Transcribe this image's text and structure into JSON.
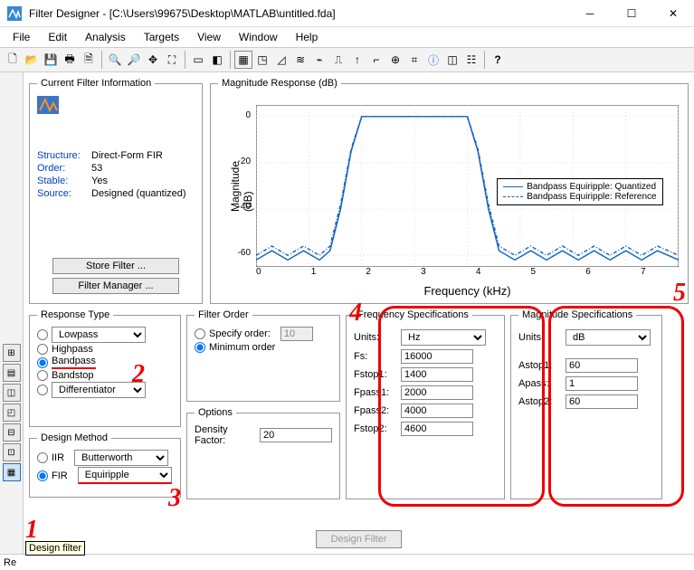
{
  "title": "Filter Designer   -   [C:\\Users\\99675\\Desktop\\MATLAB\\untitled.fda]",
  "menu": [
    "File",
    "Edit",
    "Analysis",
    "Targets",
    "View",
    "Window",
    "Help"
  ],
  "filter_info": {
    "legend": "Current Filter Information",
    "structure_label": "Structure:",
    "structure": "Direct-Form FIR",
    "order_label": "Order:",
    "order": "53",
    "stable_label": "Stable:",
    "stable": "Yes",
    "source_label": "Source:",
    "source": "Designed (quantized)",
    "store_btn": "Store Filter ...",
    "manager_btn": "Filter Manager ..."
  },
  "magresp": {
    "legend": "Magnitude Response (dB)",
    "ylabel": "Magnitude (dB)",
    "xlabel": "Frequency (kHz)",
    "yticks": [
      "0",
      "-20",
      "-40",
      "-60"
    ],
    "xticks": [
      "0",
      "1",
      "2",
      "3",
      "4",
      "5",
      "6",
      "7"
    ],
    "legend1": "Bandpass Equiripple: Quantized",
    "legend2": "Bandpass Equiripple: Reference"
  },
  "resp_type": {
    "legend": "Response Type",
    "lowpass": "Lowpass",
    "highpass": "Highpass",
    "bandpass": "Bandpass",
    "bandstop": "Bandstop",
    "diff": "Differentiator"
  },
  "design_method": {
    "legend": "Design Method",
    "iir": "IIR",
    "iir_sel": "Butterworth",
    "fir": "FIR",
    "fir_sel": "Equiripple"
  },
  "filter_order": {
    "legend": "Filter Order",
    "specify": "Specify order:",
    "specify_val": "10",
    "min": "Minimum order"
  },
  "options": {
    "legend": "Options",
    "density": "Density Factor:",
    "density_val": "20"
  },
  "freq": {
    "legend": "Frequency Specifications",
    "units": "Units:",
    "units_val": "Hz",
    "fs": "Fs:",
    "fs_val": "16000",
    "fstop1": "Fstop1:",
    "fstop1_val": "1400",
    "fpass1": "Fpass1:",
    "fpass1_val": "2000",
    "fpass2": "Fpass2:",
    "fpass2_val": "4000",
    "fstop2": "Fstop2:",
    "fstop2_val": "4600"
  },
  "mag": {
    "legend": "Magnitude Specifications",
    "units": "Units:",
    "units_val": "dB",
    "astop1": "Astop1:",
    "astop1_val": "60",
    "apass": "Apass:",
    "apass_val": "1",
    "astop2": "Astop2:",
    "astop2_val": "60"
  },
  "design_btn": "Design Filter",
  "status": "Re",
  "tooltip": "Design filter",
  "anno": {
    "n1": "1",
    "n2": "2",
    "n3": "3",
    "n4": "4",
    "n5": "5"
  },
  "chart_data": {
    "type": "line",
    "title": "Magnitude Response (dB)",
    "xlabel": "Frequency (kHz)",
    "ylabel": "Magnitude (dB)",
    "xlim": [
      0,
      8
    ],
    "ylim": [
      -65,
      5
    ],
    "series": [
      {
        "name": "Bandpass Equiripple: Quantized",
        "style": "solid",
        "x": [
          0,
          0.3,
          0.6,
          0.9,
          1.2,
          1.4,
          1.6,
          1.8,
          2.0,
          3.0,
          4.0,
          4.2,
          4.4,
          4.6,
          4.9,
          5.2,
          5.5,
          5.8,
          6.1,
          6.4,
          6.7,
          7.0,
          7.3,
          7.6,
          8.0
        ],
        "y": [
          -62,
          -58,
          -62,
          -58,
          -62,
          -58,
          -40,
          -15,
          0,
          0,
          0,
          -15,
          -40,
          -58,
          -62,
          -58,
          -62,
          -58,
          -62,
          -58,
          -62,
          -58,
          -62,
          -58,
          -62
        ]
      },
      {
        "name": "Bandpass Equiripple: Reference",
        "style": "dashdot",
        "x": [
          0,
          0.3,
          0.6,
          0.9,
          1.2,
          1.4,
          1.6,
          1.8,
          2.0,
          3.0,
          4.0,
          4.2,
          4.4,
          4.6,
          4.9,
          5.2,
          5.5,
          5.8,
          6.1,
          6.4,
          6.7,
          7.0,
          7.3,
          7.6,
          8.0
        ],
        "y": [
          -60,
          -56,
          -60,
          -56,
          -60,
          -56,
          -38,
          -14,
          0,
          0,
          0,
          -14,
          -38,
          -56,
          -60,
          -56,
          -60,
          -56,
          -60,
          -56,
          -60,
          -56,
          -60,
          -56,
          -60
        ]
      }
    ]
  }
}
